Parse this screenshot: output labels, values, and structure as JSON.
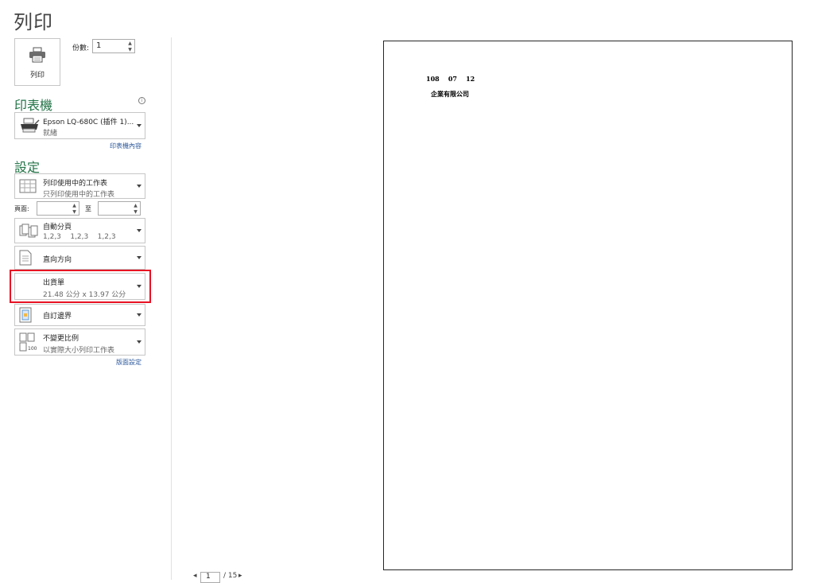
{
  "title": "列印",
  "print_button": {
    "label": "列印",
    "icon": "printer-icon"
  },
  "copies": {
    "label": "份數:",
    "value": "1"
  },
  "printer": {
    "section_title": "印表機",
    "name": "Epson LQ-680C (插件 1)...",
    "status": "就緒",
    "properties_link": "印表機內容"
  },
  "settings": {
    "section_title": "設定",
    "print_what": {
      "title": "列印使用中的工作表",
      "subtitle": "只列印使用中的工作表"
    },
    "pages": {
      "label": "頁面:",
      "to_label": "至",
      "from_value": "",
      "to_value": ""
    },
    "collation": {
      "title": "自動分頁",
      "subtitle": "1,2,3    1,2,3    1,2,3"
    },
    "orientation": {
      "title": "直向方向"
    },
    "paper_size": {
      "title": "出貨單",
      "subtitle": "21.48 公分 x 13.97 公分"
    },
    "margins": {
      "title": "自訂邊界"
    },
    "scaling": {
      "title": "不變更比例",
      "subtitle": "以實際大小列印工作表"
    },
    "page_setup_link": "版面設定"
  },
  "preview": {
    "date_line": "108    07    12",
    "company": "企業有限公司"
  },
  "pagination": {
    "current": "1",
    "total": "/ 15"
  },
  "colors": {
    "accent_green": "#217346",
    "highlight_red": "#e81123",
    "link_blue": "#2b579a"
  }
}
